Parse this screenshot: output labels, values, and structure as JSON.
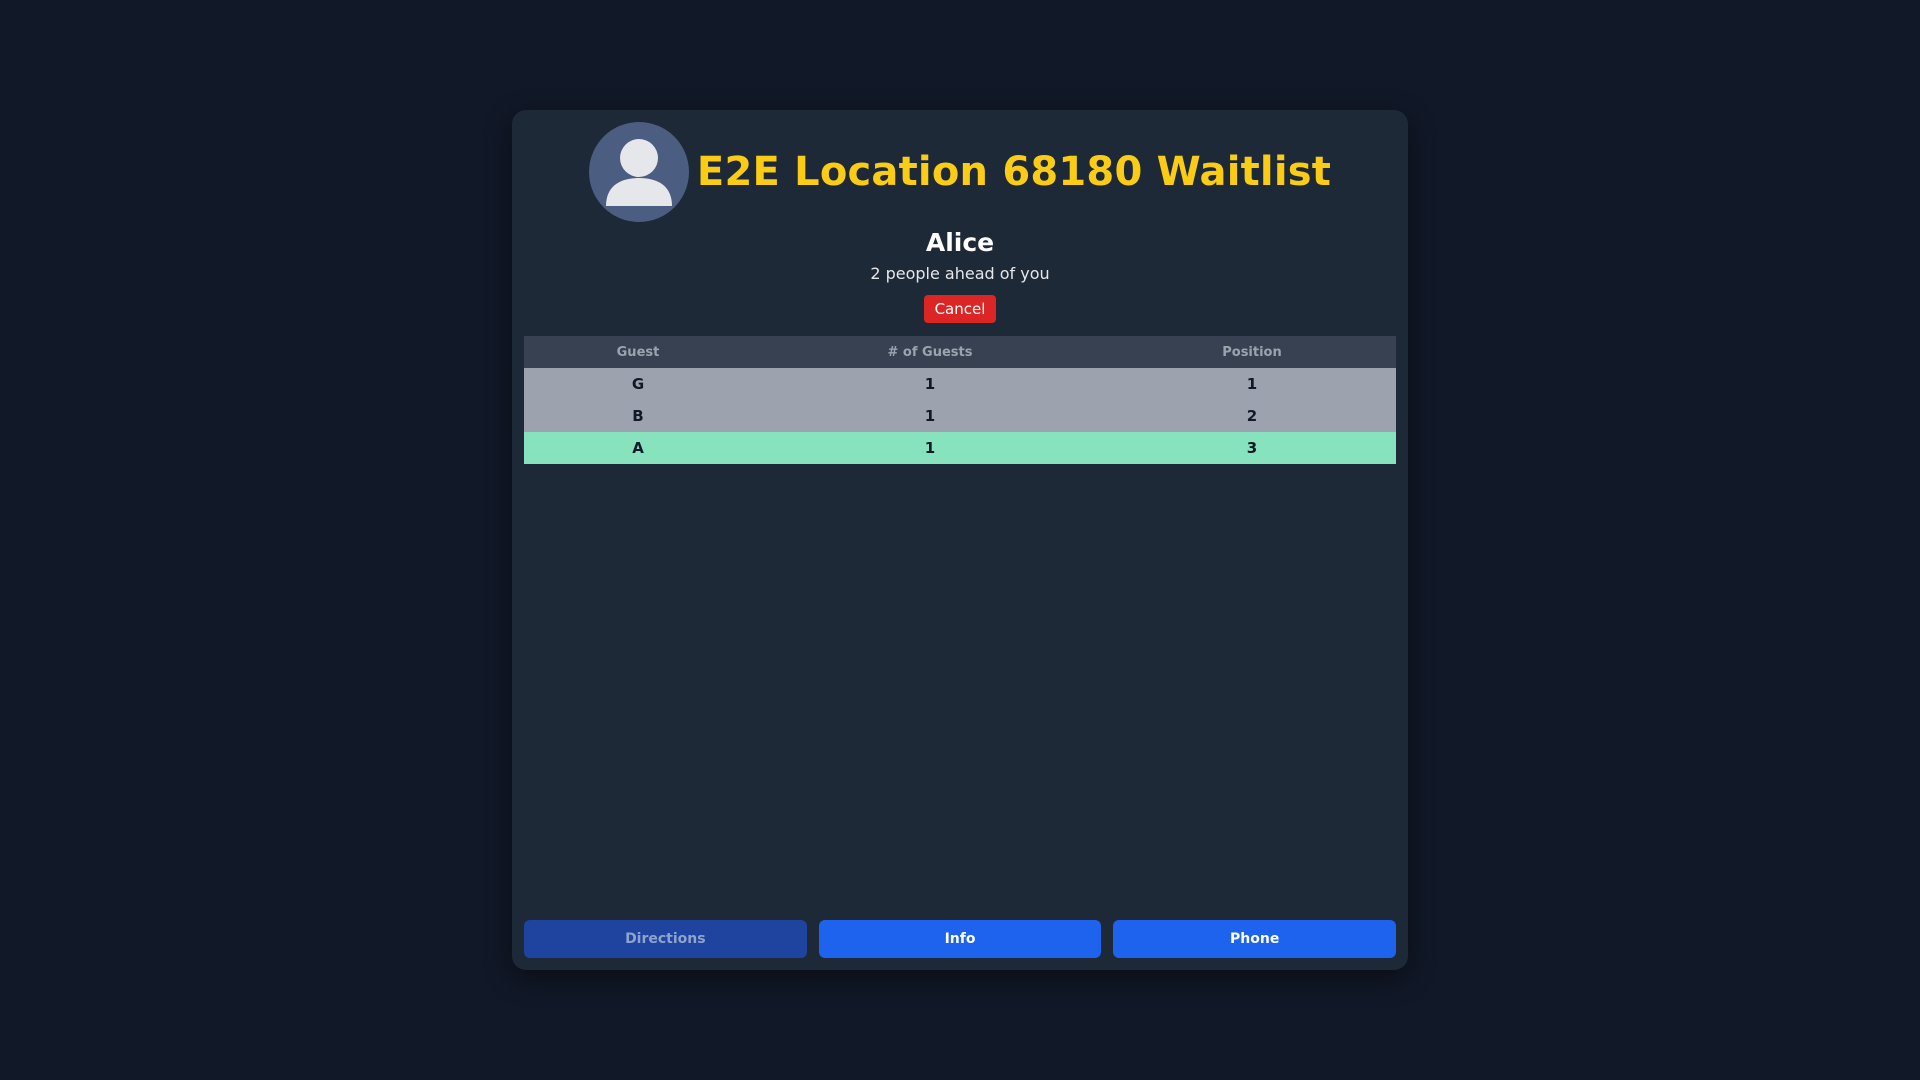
{
  "header": {
    "title": "E2E Location 68180 Waitlist",
    "avatar_icon": "user-avatar-icon"
  },
  "user": {
    "name": "Alice",
    "ahead_text": "2 people ahead of you",
    "cancel_label": "Cancel"
  },
  "table": {
    "columns": [
      "Guest",
      "# of Guests",
      "Position"
    ],
    "rows": [
      {
        "guest": "G",
        "count": "1",
        "position": "1",
        "current": false
      },
      {
        "guest": "B",
        "count": "1",
        "position": "2",
        "current": false
      },
      {
        "guest": "A",
        "count": "1",
        "position": "3",
        "current": true
      }
    ]
  },
  "footer": {
    "directions_label": "Directions",
    "info_label": "Info",
    "phone_label": "Phone"
  },
  "colors": {
    "page_bg": "#111827",
    "card_bg": "#1e2937",
    "title": "#facc15",
    "cancel": "#dc2626",
    "row": "#9ca3af",
    "current_row": "#86e3bd",
    "button": "#1d63ed",
    "button_disabled": "#1e44a0"
  }
}
